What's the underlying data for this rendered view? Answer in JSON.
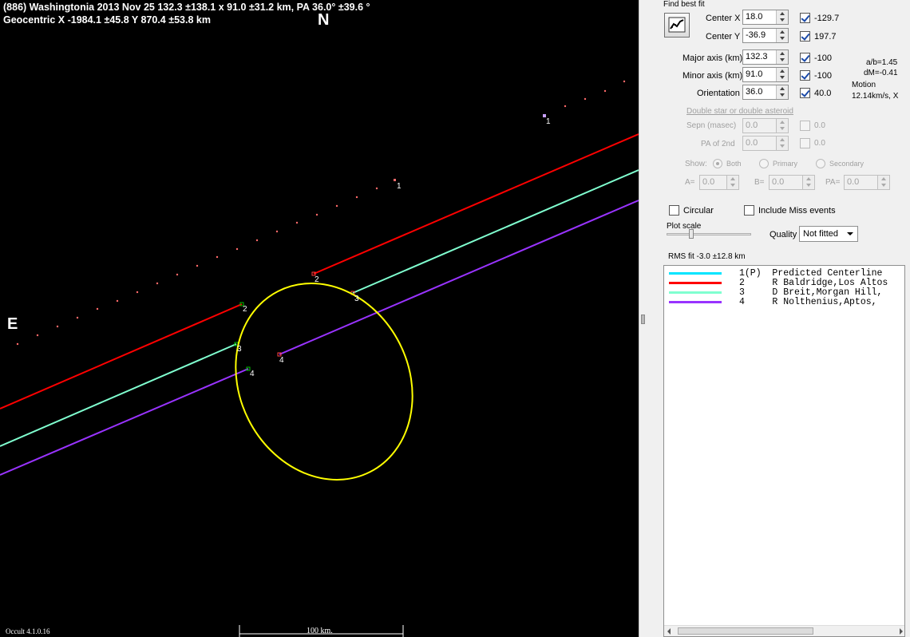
{
  "plot": {
    "title_line1": "(886) Washingtonia  2013 Nov 25   132.3 ±138.1 x 91.0 ±31.2 km,  PA 36.0° ±39.6 °",
    "title_line2": "Geocentric  X  -1984.1 ±45.8  Y 870.4 ±53.8 km",
    "north_label": "N",
    "east_label": "E",
    "version": "Occult 4.1.0.16",
    "scale_label": "100 km.",
    "chord_labels": [
      "1",
      "1",
      "2",
      "2",
      "3",
      "3",
      "4",
      "4"
    ],
    "colors": {
      "background": "#000000",
      "ellipse": "#ffff00",
      "chord_2": "#ff0000",
      "chord_3": "#80ffd0",
      "chord_4": "#9933ff",
      "predicted": "#00e5ff"
    }
  },
  "panel": {
    "find_best_fit": "Find best fit",
    "fit_button_icon": "fit-graph-icon",
    "fields": [
      {
        "label": "Center X",
        "value": "18.0",
        "checked": true,
        "aux": "-129.7"
      },
      {
        "label": "Center Y",
        "value": "-36.9",
        "checked": true,
        "aux": "197.7"
      },
      {
        "label": "Major axis (km)",
        "value": "132.3",
        "checked": true,
        "aux": "-100"
      },
      {
        "label": "Minor axis (km)",
        "value": "91.0",
        "checked": true,
        "aux": "-100"
      },
      {
        "label": "Orientation",
        "value": "36.0",
        "checked": true,
        "aux": "40.0"
      }
    ],
    "ratio_ab": "a/b=1.45",
    "dm": "dM=-0.41",
    "motion_label": "Motion",
    "motion_value": "12.14km/s, X",
    "double_star_link": "Double star  or  double asteroid",
    "sepn_label": "Sepn (masec)",
    "sepn_value": "0.0",
    "sepn_aux": "0.0",
    "pa2_label": "PA of 2nd",
    "pa2_value": "0.0",
    "pa2_aux": "0.0",
    "show_label": "Show:",
    "show_options": [
      "Both",
      "Primary",
      "Secondary"
    ],
    "show_selected": "Both",
    "a_label": "A=",
    "a_value": "0.0",
    "b_label": "B=",
    "b_value": "0.0",
    "pa_label": "PA=",
    "pa_value": "0.0",
    "circular_label": "Circular",
    "include_miss_label": "Include Miss events",
    "plot_scale_label": "Plot scale",
    "quality_label": "Quality",
    "quality_value": "Not fitted",
    "rms_fit": "RMS fit  -3.0 ±12.8 km",
    "legend": [
      {
        "text": "1(P)  Predicted Centerline",
        "color": "#00e5ff"
      },
      {
        "text": "2     R Baldridge,Los Altos",
        "color": "#ff0000"
      },
      {
        "text": "3     D Breit,Morgan Hill,",
        "color": "#80ffd0"
      },
      {
        "text": "4     R Nolthenius,Aptos,",
        "color": "#9933ff"
      }
    ]
  }
}
